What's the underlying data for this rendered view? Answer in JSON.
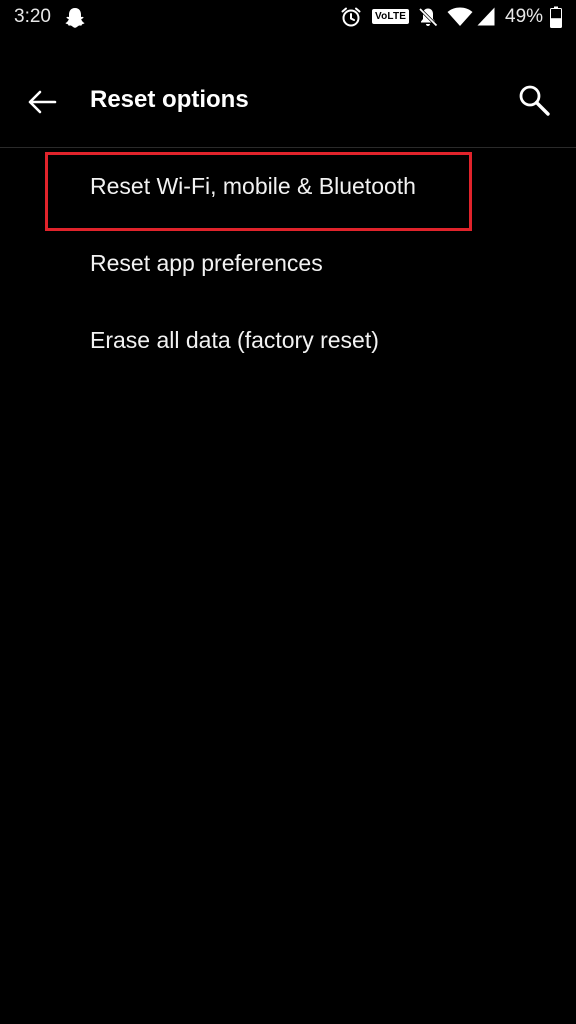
{
  "status_bar": {
    "time": "3:20",
    "volte_label": "VoLTE",
    "battery_percent": "49%",
    "battery_level": 0.49,
    "icons": [
      "snapchat-ghost-icon",
      "alarm-icon",
      "volte-icon",
      "notifications-muted-icon",
      "wifi-icon",
      "cellular-signal-icon",
      "battery-icon"
    ]
  },
  "toolbar": {
    "title": "Reset options",
    "back_icon": "arrow-back-icon",
    "search_icon": "search-icon"
  },
  "options": [
    {
      "label": "Reset Wi-Fi, mobile & Bluetooth",
      "highlighted": true
    },
    {
      "label": "Reset app preferences",
      "highlighted": false
    },
    {
      "label": "Erase all data (factory reset)",
      "highlighted": false
    }
  ],
  "colors": {
    "background": "#000000",
    "text": "#ffffff",
    "highlight": "#e0232b"
  }
}
